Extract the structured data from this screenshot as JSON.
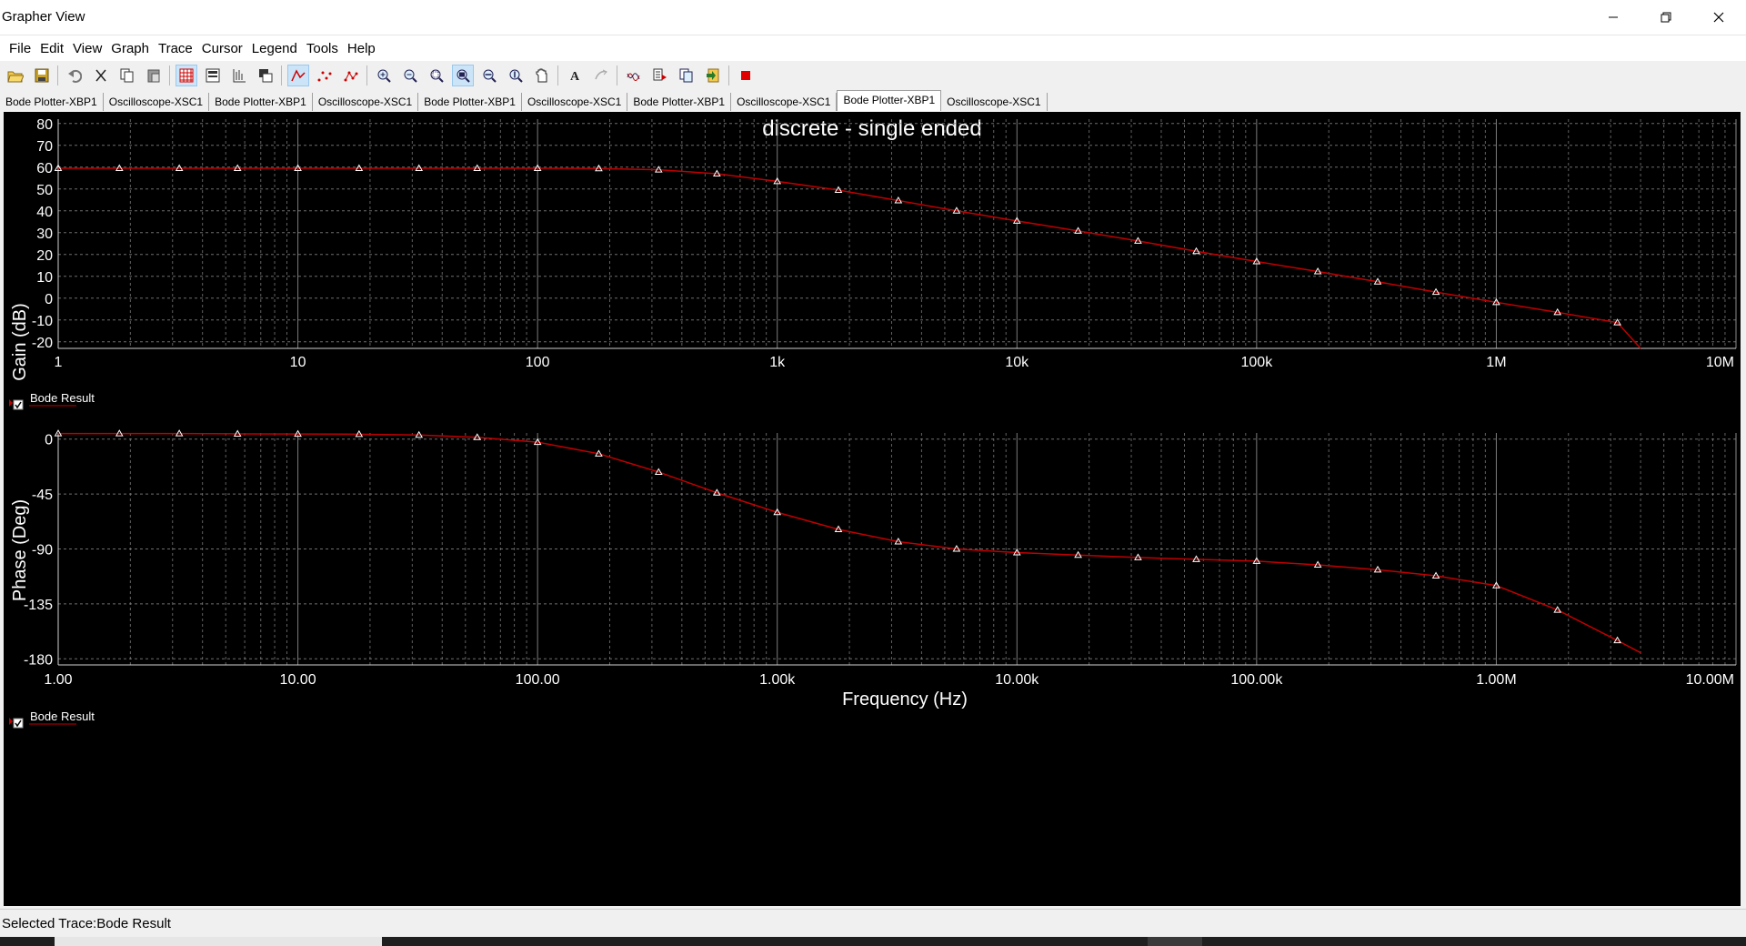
{
  "window": {
    "title": "Grapher View",
    "minimize_icon": "minimize-icon",
    "restore_icon": "restore-icon",
    "close_icon": "close-icon"
  },
  "menu": [
    "File",
    "Edit",
    "View",
    "Graph",
    "Trace",
    "Cursor",
    "Legend",
    "Tools",
    "Help"
  ],
  "toolbar": {
    "icons": [
      "open-folder-icon",
      "save-icon",
      "undo-icon",
      "cut-icon",
      "copy-icon",
      "paste-icon",
      "grid-icon",
      "legend-icon",
      "ticks-icon",
      "overlay-icon",
      "lines-icon",
      "points-icon",
      "line-points-icon",
      "zoom-in-icon",
      "zoom-out-icon",
      "zoom-area-icon",
      "zoom-full-icon",
      "zoom-x-icon",
      "zoom-y-icon",
      "pan-icon",
      "text-icon",
      "properties-icon",
      "overlay-traces-icon",
      "export-icon",
      "copy-graph-icon",
      "import-icon",
      "stop-icon"
    ]
  },
  "tabs": [
    {
      "label": "Bode Plotter-XBP1",
      "active": false
    },
    {
      "label": "Oscilloscope-XSC1",
      "active": false
    },
    {
      "label": "Bode Plotter-XBP1",
      "active": false
    },
    {
      "label": "Oscilloscope-XSC1",
      "active": false
    },
    {
      "label": "Bode Plotter-XBP1",
      "active": false
    },
    {
      "label": "Oscilloscope-XSC1",
      "active": false
    },
    {
      "label": "Bode Plotter-XBP1",
      "active": false
    },
    {
      "label": "Oscilloscope-XSC1",
      "active": false
    },
    {
      "label": "Bode Plotter-XBP1",
      "active": true
    },
    {
      "label": "Oscilloscope-XSC1",
      "active": false
    }
  ],
  "status": {
    "text": "Selected Trace:Bode Result"
  },
  "colors": {
    "background": "#000000",
    "trace": "#c00000",
    "grid": "#8a8a8a",
    "text": "#ffffff"
  },
  "chart_data": [
    {
      "type": "line",
      "title": "discrete - single ended",
      "xlabel": "",
      "ylabel": "Gain (dB)",
      "xscale": "log",
      "xlim": [
        1,
        10000000
      ],
      "ylim": [
        -23,
        82
      ],
      "x_tick_values": [
        1,
        10,
        100,
        1000,
        10000,
        100000,
        1000000,
        10000000
      ],
      "x_tick_labels": [
        "1",
        "10",
        "100",
        "1k",
        "10k",
        "100k",
        "1M",
        "10M"
      ],
      "y_ticks": [
        80,
        70,
        60,
        50,
        40,
        30,
        20,
        10,
        0,
        -10,
        -20
      ],
      "grid": true,
      "legend": "Bode Result",
      "series": [
        {
          "name": "Bode Result",
          "x": [
            1,
            1.8,
            3.2,
            5.6,
            10,
            18,
            32,
            56,
            100,
            180,
            320,
            560,
            1000,
            1800,
            3200,
            5600,
            10000,
            18000,
            32000,
            56000,
            100000,
            180000,
            320000,
            560000,
            1000000,
            1800000,
            3200000,
            4000000
          ],
          "values": [
            59.5,
            59.5,
            59.5,
            59.5,
            59.5,
            59.5,
            59.5,
            59.5,
            59.5,
            59.4,
            58.8,
            57,
            53.5,
            49.5,
            44.7,
            40,
            35.4,
            30.8,
            26.2,
            21.5,
            16.8,
            12.2,
            7.5,
            2.8,
            -1.9,
            -6.5,
            -11.2,
            -23
          ]
        }
      ]
    },
    {
      "type": "line",
      "title": "",
      "xlabel": "Frequency (Hz)",
      "ylabel": "Phase (Deg)",
      "xscale": "log",
      "xlim": [
        1,
        10000000
      ],
      "ylim": [
        -185,
        5
      ],
      "x_tick_values": [
        1,
        10,
        100,
        1000,
        10000,
        100000,
        1000000,
        10000000
      ],
      "x_tick_labels": [
        "1.00",
        "10.00",
        "100.00",
        "1.00k",
        "10.00k",
        "100.00k",
        "1.00M",
        "10.00M"
      ],
      "y_ticks": [
        0,
        -45,
        -90,
        -135,
        -180
      ],
      "grid": true,
      "legend": "Bode Result",
      "series": [
        {
          "name": "Bode Result",
          "x": [
            1,
            1.8,
            3.2,
            5.6,
            10,
            18,
            32,
            56,
            100,
            180,
            320,
            560,
            1000,
            1800,
            3200,
            5600,
            10000,
            18000,
            32000,
            56000,
            100000,
            180000,
            320000,
            560000,
            1000000,
            1800000,
            3200000,
            4000000
          ],
          "values": [
            4.5,
            4.5,
            4.5,
            4.3,
            4.2,
            4,
            3.3,
            1.5,
            -2.5,
            -12,
            -27,
            -44,
            -60,
            -74,
            -84,
            -90,
            -93,
            -95,
            -97,
            -98.5,
            -100,
            -103,
            -107,
            -112,
            -120,
            -140,
            -165,
            -175
          ]
        }
      ]
    }
  ]
}
